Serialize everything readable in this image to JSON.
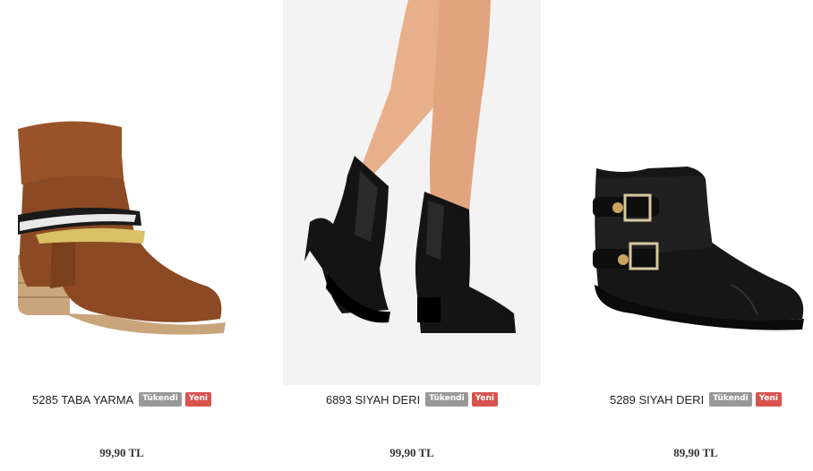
{
  "products": [
    {
      "name": "5285 TABA YARMA",
      "badges": [
        "Tükendi",
        "Yeni"
      ],
      "price": "99,90 TL",
      "image_icon": "brown-suede-boot-with-strap-icon"
    },
    {
      "name": "6893 SIYAH DERI",
      "badges": [
        "Tükendi",
        "Yeni"
      ],
      "price": "99,90 TL",
      "image_icon": "black-heeled-chelsea-boots-on-legs-icon"
    },
    {
      "name": "5289 SIYAH DERI",
      "badges": [
        "Tükendi",
        "Yeni"
      ],
      "price": "89,90 TL",
      "image_icon": "black-buckle-ankle-boot-icon"
    }
  ],
  "colors": {
    "badge_soldout": "#999999",
    "badge_new": "#d9534f",
    "price_text": "#333333"
  }
}
